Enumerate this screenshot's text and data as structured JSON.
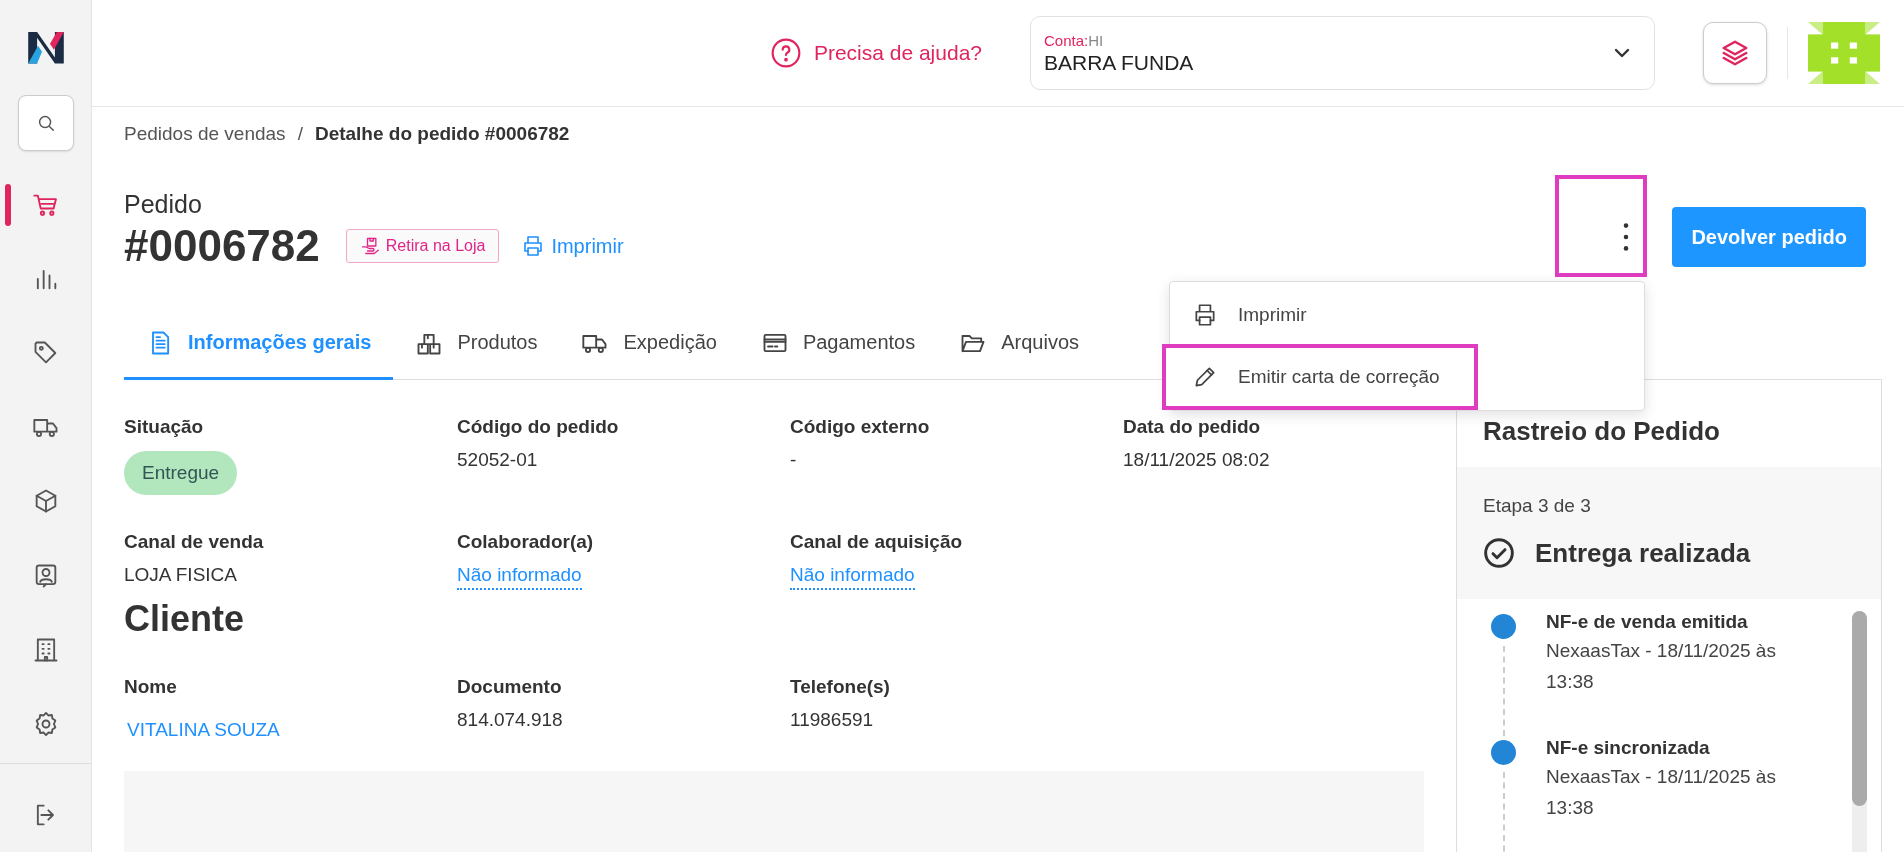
{
  "sidebar": {
    "items": [
      {
        "kind": "search",
        "selected": false
      },
      {
        "kind": "cart",
        "selected": true
      },
      {
        "kind": "chart",
        "selected": false
      },
      {
        "kind": "tag",
        "selected": false
      },
      {
        "kind": "truck",
        "selected": false
      },
      {
        "kind": "cube",
        "selected": false
      },
      {
        "kind": "contact",
        "selected": false
      },
      {
        "kind": "building",
        "selected": false
      },
      {
        "kind": "gear",
        "selected": false
      },
      {
        "kind": "logout",
        "selected": false
      }
    ]
  },
  "topbar": {
    "help": "Precisa de ajuda?",
    "account": {
      "label": "Conta:",
      "code": "HI",
      "value": "BARRA FUNDA"
    }
  },
  "breadcrumb": {
    "items": [
      "Pedidos de vendas",
      "Detalhe do pedido #0006782"
    ],
    "separator": "/"
  },
  "header": {
    "title": "Pedido",
    "number": "#0006782",
    "tag": "Retira na Loja",
    "print_link": "Imprimir",
    "primary_button": "Devolver pedido"
  },
  "menu": {
    "items": [
      {
        "kind": "print",
        "label": "Imprimir",
        "highlighted": false
      },
      {
        "kind": "edit",
        "label": "Emitir carta de correção",
        "highlighted": true
      }
    ]
  },
  "tabs": [
    {
      "kind": "doc",
      "label": "Informações gerais",
      "selected": true
    },
    {
      "kind": "boxes",
      "label": "Produtos",
      "selected": false
    },
    {
      "kind": "truck",
      "label": "Expedição",
      "selected": false
    },
    {
      "kind": "card",
      "label": "Pagamentos",
      "selected": false
    },
    {
      "kind": "folder",
      "label": "Arquivos",
      "selected": false
    }
  ],
  "details": [
    {
      "label": "Situação",
      "value": "Entregue",
      "kind": "badge"
    },
    {
      "label": "Código do pedido",
      "value": "52052-01",
      "kind": "text"
    },
    {
      "label": "Código externo",
      "value": "-",
      "kind": "text"
    },
    {
      "label": "Data do pedido",
      "value": "18/11/2025 08:02",
      "kind": "text"
    },
    {
      "label": "Canal de venda",
      "value": "LOJA FISICA",
      "kind": "text"
    },
    {
      "label": "Colaborador(a)",
      "value": "Não informado",
      "kind": "dotted_link"
    },
    {
      "label": "Canal de aquisição",
      "value": "Não informado",
      "kind": "dotted_link"
    }
  ],
  "client": {
    "title": "Cliente",
    "fields": [
      {
        "label": "Nome",
        "value": "VITALINA SOUZA",
        "kind": "link"
      },
      {
        "label": "Documento",
        "value": "814.074.918",
        "kind": "text"
      },
      {
        "label": "Telefone(s)",
        "value": "11986591",
        "kind": "text"
      }
    ]
  },
  "tracking": {
    "title": "Rastreio do Pedido",
    "step": "Etapa 3 de 3",
    "status": "Entrega realizada",
    "events": [
      {
        "title": "NF-e de venda emitida",
        "detail": "NexaasTax - 18/11/2025 às 13:38"
      },
      {
        "title": "NF-e sincronizada",
        "detail": "NexaasTax - 18/11/2025 às 13:38"
      }
    ]
  }
}
